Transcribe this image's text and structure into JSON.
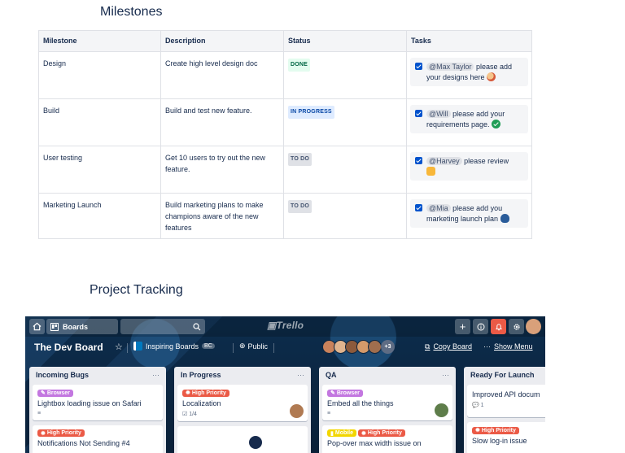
{
  "milestones": {
    "heading": "Milestones",
    "columns": [
      "Milestone",
      "Description",
      "Status",
      "Tasks"
    ],
    "rows": [
      {
        "milestone": "Design",
        "description": "Create high level design doc",
        "status": "DONE",
        "task_mention": "@Max Taylor",
        "task_text": "please add your designs here",
        "task_emoji": "artist-emoji"
      },
      {
        "milestone": "Build",
        "description": "Build and test new feature.",
        "status": "IN PROGRESS",
        "task_mention": "@Will",
        "task_text": "please add your requirements page.",
        "task_emoji": "check-emoji"
      },
      {
        "milestone": "User testing",
        "description": "Get 10 users to try out the new feature.",
        "status": "TO DO",
        "task_mention": "@Harvey",
        "task_text": "please review",
        "task_emoji": "thumbs-up-emoji"
      },
      {
        "milestone": "Marketing Launch",
        "description": "Build marketing plans to make champions aware of the new features",
        "status": "TO DO",
        "task_mention": "@Mia",
        "task_text": "please add you marketing launch plan",
        "task_emoji": "speaking-head-emoji"
      }
    ]
  },
  "tracking": {
    "heading": "Project Tracking"
  },
  "trello": {
    "topbar": {
      "home_icon": "home-icon",
      "boards_label": "Boards",
      "logo_text": "Trello"
    },
    "board": {
      "title": "The Dev Board",
      "team": "Inspiring Boards",
      "team_badge": "BC",
      "visibility": "Public",
      "members_more": "+3",
      "copy_label": "Copy Board",
      "menu_dots": "···",
      "menu_label": "Show Menu"
    },
    "lists": [
      {
        "name": "Incoming Bugs",
        "more": "···",
        "cards": [
          {
            "labels": [
              "Browser"
            ],
            "title": "Lightbox loading issue on Safari",
            "meta": "≡"
          },
          {
            "labels": [
              "High Priority"
            ],
            "title": "Notifications Not Sending #4",
            "meta": ""
          }
        ]
      },
      {
        "name": "In Progress",
        "more": "···",
        "cards": [
          {
            "labels": [
              "High Priority"
            ],
            "title": "Localization",
            "meta": "☑ 1/4"
          },
          {
            "labels": [],
            "title": "",
            "meta": ""
          }
        ]
      },
      {
        "name": "QA",
        "more": "···",
        "cards": [
          {
            "labels": [
              "Browser"
            ],
            "title": "Embed all the things",
            "meta": "≡"
          },
          {
            "labels": [
              "Mobile",
              "High Priority"
            ],
            "title": "Pop-over max width issue on",
            "meta": ""
          }
        ]
      },
      {
        "name": "Ready For Launch",
        "more": "",
        "cards": [
          {
            "labels": [],
            "title": "Improved API docum",
            "meta": "💬 1"
          },
          {
            "labels": [
              "High Priority"
            ],
            "title": "Slow log-in issue",
            "meta": ""
          }
        ]
      }
    ],
    "colors": {
      "label_purple": "#c377e0",
      "label_red": "#eb5a46",
      "label_yellow": "#f2d600",
      "notif_red": "#eb5a46"
    }
  }
}
